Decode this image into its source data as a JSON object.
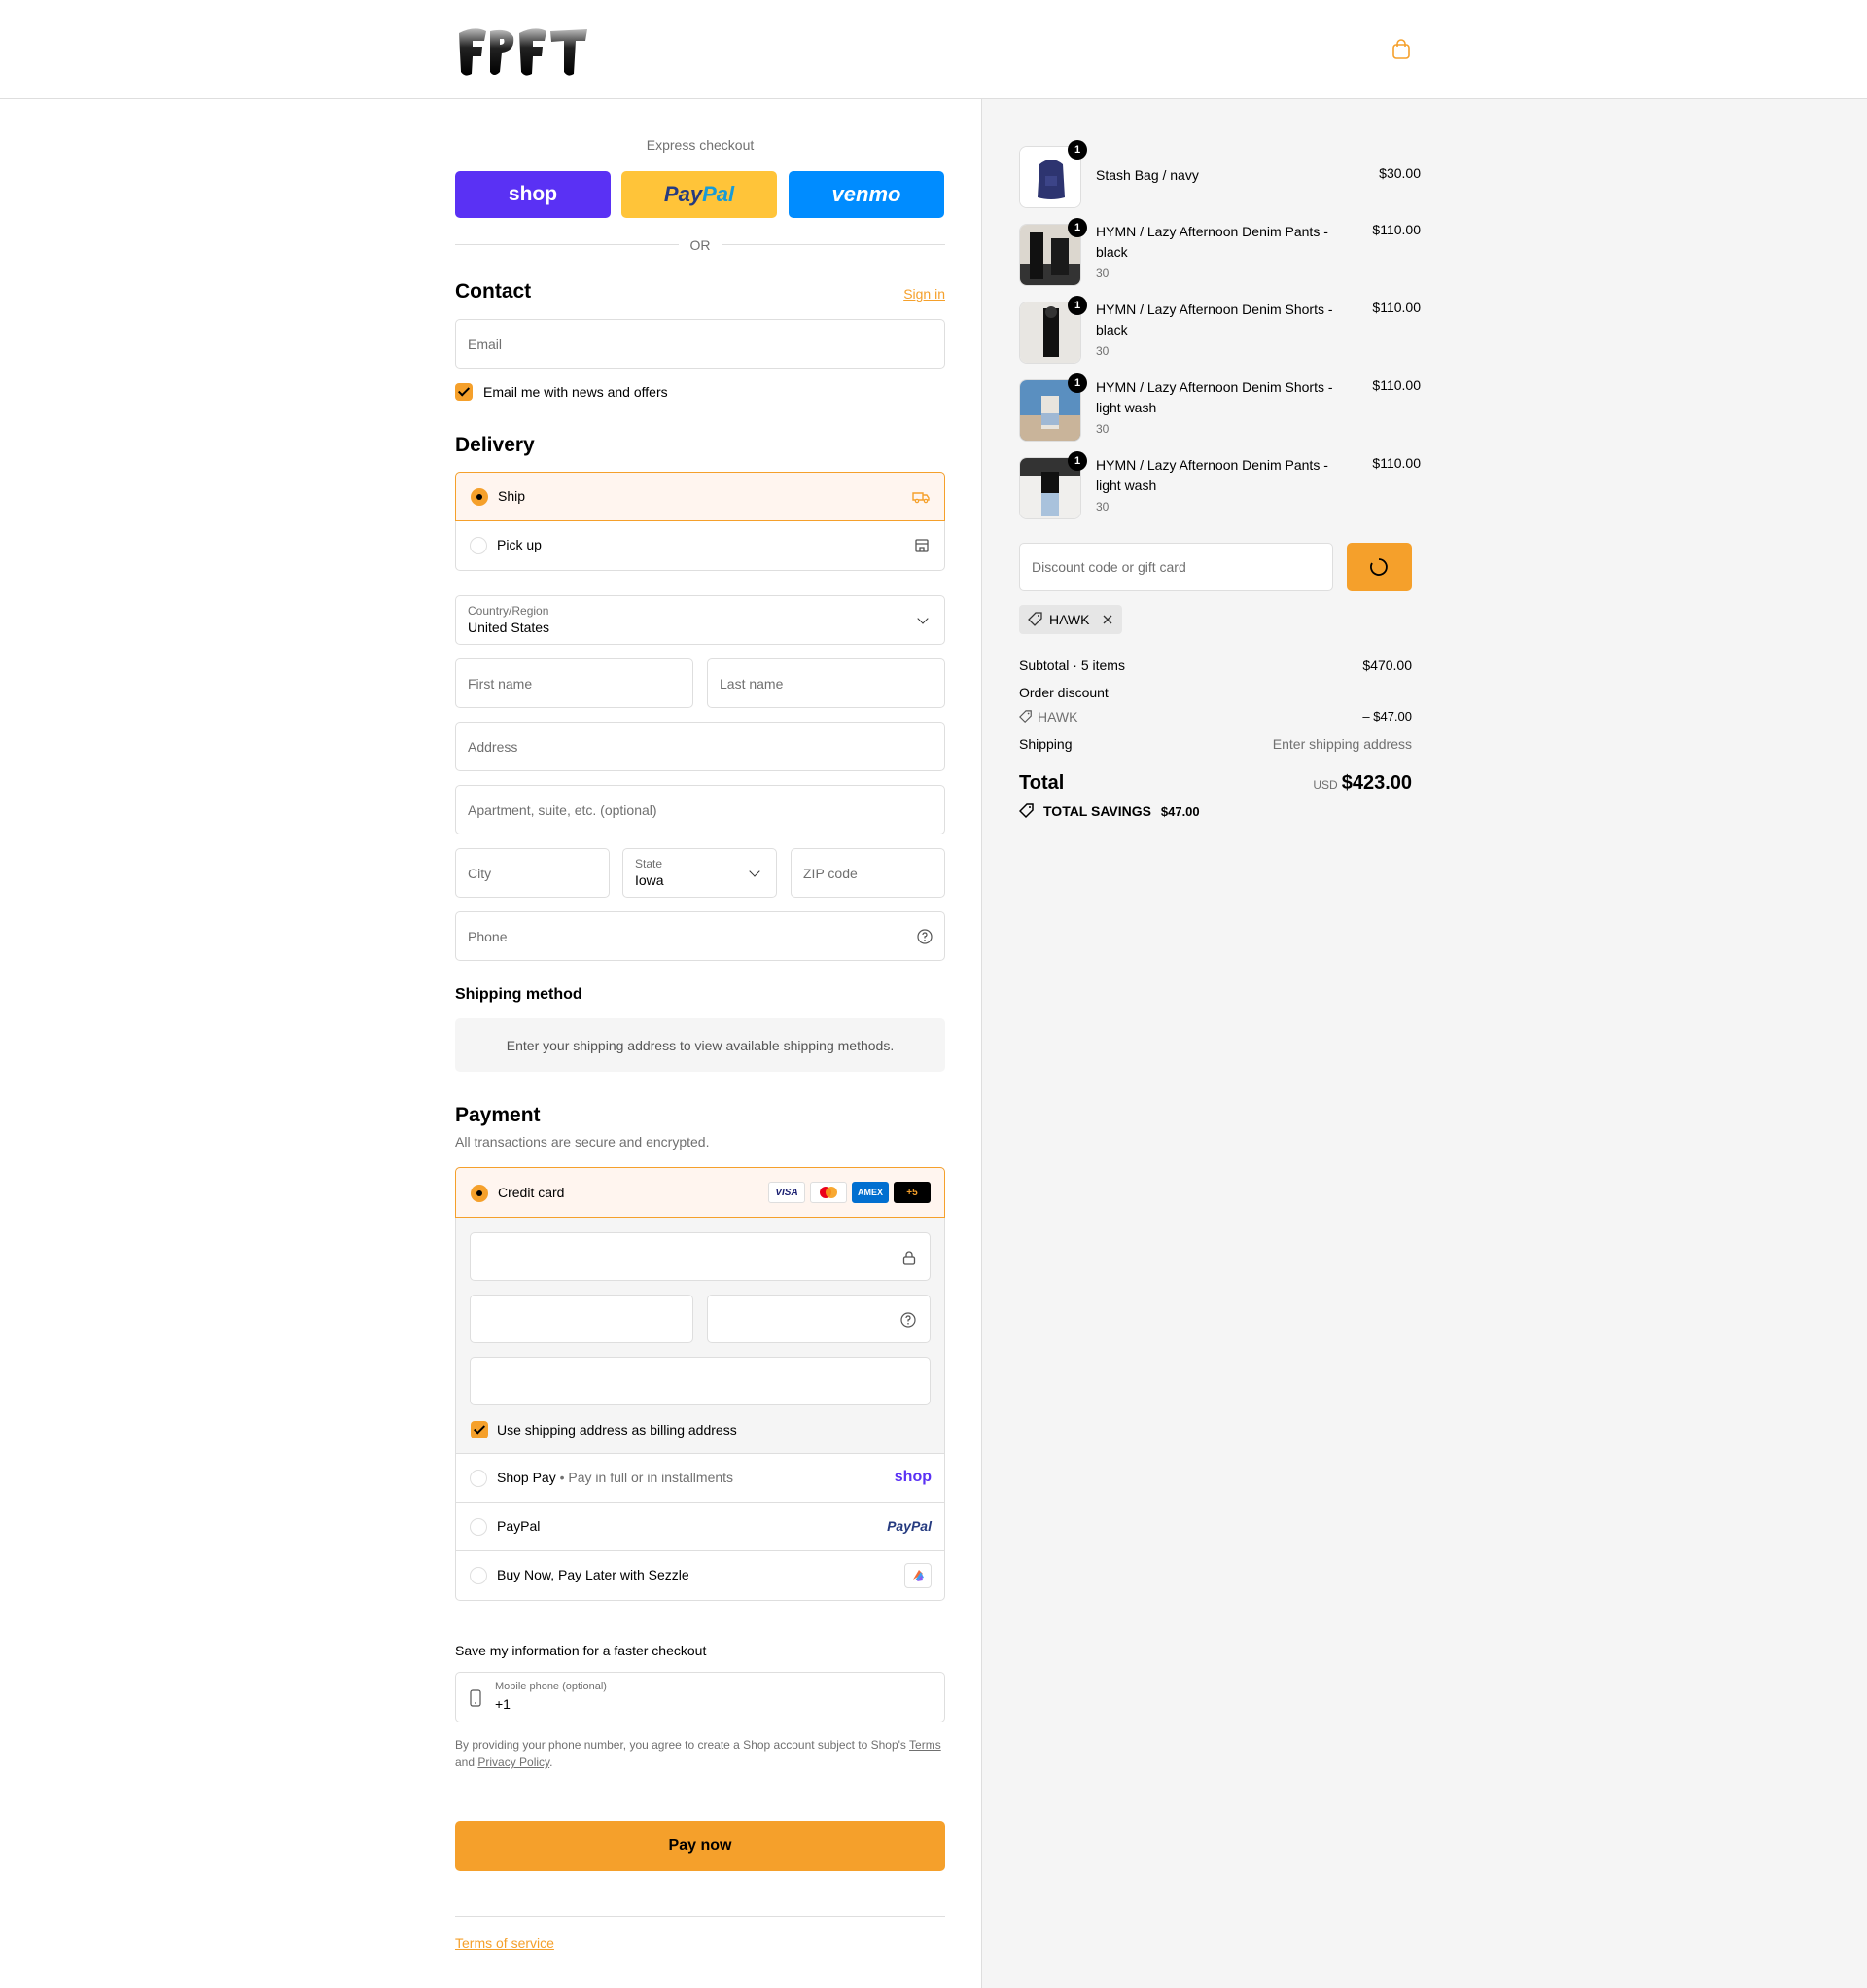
{
  "header": {
    "logo_text": "FPFT",
    "cart_icon": "shopping-bag-icon",
    "accent_color": "#f5a02b"
  },
  "express": {
    "title": "Express checkout",
    "shop_label": "shop",
    "paypal_label_a": "Pay",
    "paypal_label_b": "Pal",
    "venmo_label": "venmo",
    "or_label": "OR"
  },
  "contact": {
    "heading": "Contact",
    "sign_in": "Sign in",
    "email_placeholder": "Email",
    "news_label": "Email me with news and offers",
    "news_checked": true
  },
  "delivery": {
    "heading": "Delivery",
    "options": [
      {
        "label": "Ship",
        "selected": true,
        "icon": "truck-icon"
      },
      {
        "label": "Pick up",
        "selected": false,
        "icon": "store-icon"
      }
    ],
    "country_label": "Country/Region",
    "country_value": "United States",
    "first_name": "First name",
    "last_name": "Last name",
    "address": "Address",
    "apartment": "Apartment, suite, etc. (optional)",
    "city": "City",
    "state_label": "State",
    "state_value": "Iowa",
    "zip": "ZIP code",
    "phone": "Phone"
  },
  "shipping_method": {
    "heading": "Shipping method",
    "notice": "Enter your shipping address to view available shipping methods."
  },
  "payment": {
    "heading": "Payment",
    "subtitle": "All transactions are secure and encrypted.",
    "credit_card_label": "Credit card",
    "card_brands": [
      "VISA",
      "mastercard",
      "AMEX",
      "+5"
    ],
    "billing_label": "Use shipping address as billing address",
    "billing_checked": true,
    "shop_pay_label": "Shop Pay",
    "shop_pay_sub": "Pay in full or in installments",
    "shop_pay_logo": "shop",
    "paypal_label": "PayPal",
    "paypal_logo": "PayPal",
    "sezzle_label": "Buy Now, Pay Later with Sezzle"
  },
  "save_info": {
    "heading": "Save my information for a faster checkout",
    "phone_label": "Mobile phone (optional)",
    "phone_value": "+1",
    "legal_a": "By providing your phone number, you agree to create a Shop account subject to Shop's ",
    "terms": "Terms",
    "legal_b": "and ",
    "privacy": "Privacy Policy",
    "legal_c": "."
  },
  "pay_now": "Pay now",
  "terms_of_service": "Terms of service",
  "cart": {
    "items": [
      {
        "name": "Stash Bag / navy",
        "variant": "",
        "price": "$30.00",
        "qty": "1"
      },
      {
        "name": "HYMN / Lazy Afternoon Denim Pants - black",
        "variant": "30",
        "price": "$110.00",
        "qty": "1"
      },
      {
        "name": "HYMN / Lazy Afternoon Denim Shorts - black",
        "variant": "30",
        "price": "$110.00",
        "qty": "1"
      },
      {
        "name": "HYMN / Lazy Afternoon Denim Shorts - light wash",
        "variant": "30",
        "price": "$110.00",
        "qty": "1"
      },
      {
        "name": "HYMN / Lazy Afternoon Denim Pants - light wash",
        "variant": "30",
        "price": "$110.00",
        "qty": "1"
      }
    ],
    "discount_placeholder": "Discount code or gift card",
    "applied_code": "HAWK",
    "subtotal_label": "Subtotal · 5 items",
    "subtotal_value": "$470.00",
    "order_discount_label": "Order discount",
    "discount_code": "HAWK",
    "discount_value": "– $47.00",
    "shipping_label": "Shipping",
    "shipping_value": "Enter shipping address",
    "total_label": "Total",
    "currency": "USD",
    "total_value": "$423.00",
    "savings_label": "TOTAL SAVINGS",
    "savings_value": "$47.00"
  }
}
